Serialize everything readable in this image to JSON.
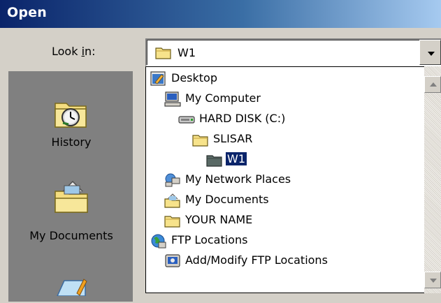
{
  "window": {
    "title": "Open"
  },
  "look_in": {
    "label_pre": "Look ",
    "label_accel": "i",
    "label_post": "n:",
    "value": "W1",
    "value_icon": "folder-icon",
    "dropdown_icon": "chevron-down-icon"
  },
  "places": [
    {
      "label": "History",
      "icon": "history-icon"
    },
    {
      "label": "My Documents",
      "icon": "my-documents-icon"
    },
    {
      "label": "",
      "icon": "desktop-icon"
    }
  ],
  "locations": [
    {
      "label": "Desktop",
      "icon": "desktop-icon"
    },
    {
      "label": "My Computer",
      "icon": "computer-icon"
    },
    {
      "label": "HARD DISK (C:)",
      "icon": "hard-disk-icon"
    },
    {
      "label": "SLISAR",
      "icon": "folder-icon"
    },
    {
      "label": "W1",
      "icon": "open-folder-icon",
      "selected": true
    },
    {
      "label": "My Network Places",
      "icon": "network-places-icon"
    },
    {
      "label": "My Documents",
      "icon": "my-documents-icon"
    },
    {
      "label": "YOUR NAME",
      "icon": "folder-icon"
    },
    {
      "label": "FTP Locations",
      "icon": "ftp-globe-icon"
    },
    {
      "label": "Add/Modify FTP Locations",
      "icon": "ftp-add-icon"
    }
  ],
  "colors": {
    "titlebar_start": "#0a246a",
    "titlebar_end": "#a6caf0",
    "selection": "#0a246a",
    "face": "#d4d0c8"
  }
}
